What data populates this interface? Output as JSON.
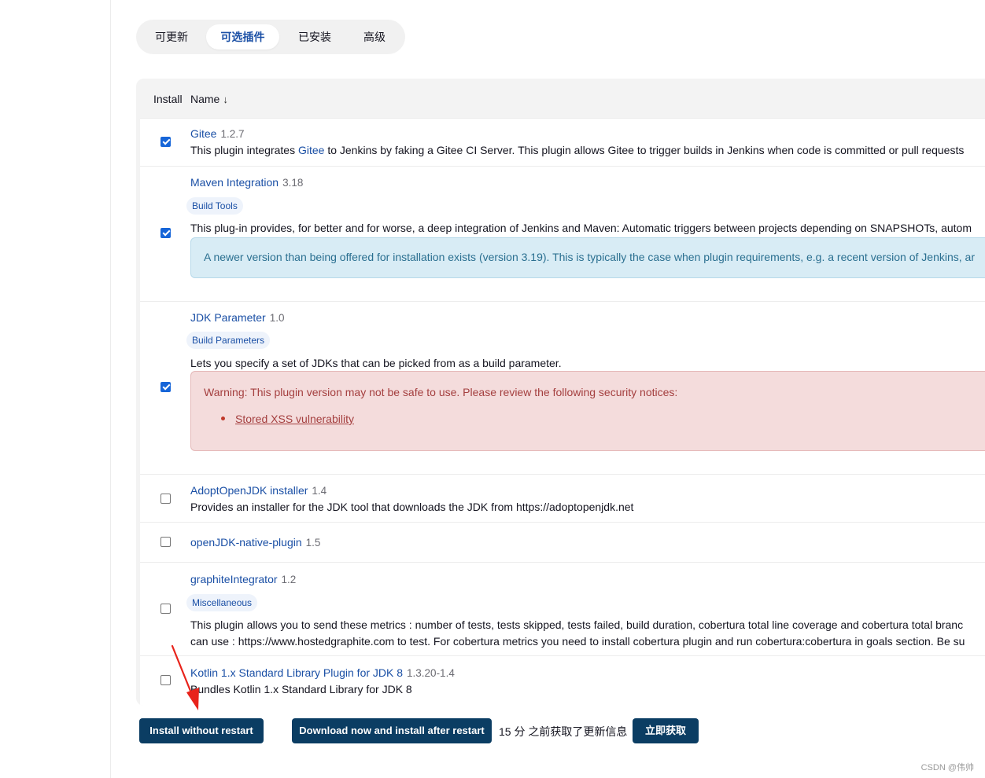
{
  "tabs": [
    {
      "label": "可更新",
      "active": false
    },
    {
      "label": "可选插件",
      "active": true
    },
    {
      "label": "已安装",
      "active": false
    },
    {
      "label": "高级",
      "active": false
    }
  ],
  "table": {
    "header": {
      "install": "Install",
      "name": "Name",
      "sort_indicator": "↓"
    }
  },
  "plugins": [
    {
      "name": "Gitee",
      "version": "1.2.7",
      "checked": true,
      "desc_before": "This plugin integrates ",
      "desc_link": "Gitee",
      "desc_after": " to Jenkins by faking a Gitee CI Server. This plugin allows Gitee to trigger builds in Jenkins when code is committed or pull requests"
    },
    {
      "name": "Maven Integration",
      "version": "3.18",
      "checked": true,
      "tag": "Build Tools",
      "desc": "This plug-in provides, for better and for worse, a deep integration of Jenkins and Maven: Automatic triggers between projects depending on SNAPSHOTs, autom",
      "notice": "A newer version than being offered for installation exists (version 3.19). This is typically the case when plugin requirements, e.g. a recent version of Jenkins, ar"
    },
    {
      "name": "JDK Parameter",
      "version": "1.0",
      "checked": true,
      "tag": "Build Parameters",
      "desc": "Lets you specify a set of JDKs that can be picked from as a build parameter.",
      "warning": "Warning: This plugin version may not be safe to use. Please review the following security notices:",
      "warning_link": "Stored XSS vulnerability"
    },
    {
      "name": "AdoptOpenJDK installer",
      "version": "1.4",
      "checked": false,
      "desc": "Provides an installer for the JDK tool that downloads the JDK from https://adoptopenjdk.net"
    },
    {
      "name": "openJDK-native-plugin",
      "version": "1.5",
      "checked": false
    },
    {
      "name": "graphiteIntegrator",
      "version": "1.2",
      "checked": false,
      "tag": "Miscellaneous",
      "desc": "This plugin allows you to send these metrics : number of tests, tests skipped, tests failed, build duration, cobertura total line coverage and cobertura total branc",
      "desc2": "can use : https://www.hostedgraphite.com to test. For cobertura metrics you need to install cobertura plugin and run cobertura:cobertura in goals section. Be su"
    },
    {
      "name": "Kotlin 1.x Standard Library Plugin for JDK 8",
      "version": "1.3.20-1.4",
      "checked": false,
      "desc": "Bundles Kotlin 1.x Standard Library for JDK 8"
    }
  ],
  "actions": {
    "install_without_restart": "Install without restart",
    "download_and_install": "Download now and install after restart",
    "update_info": "15 分 之前获取了更新信息",
    "fetch_now": "立即获取"
  },
  "watermark": "CSDN @伟帅",
  "colors": {
    "link": "#1a4fa5",
    "button": "#0b3d63",
    "checkbox": "#1665d8",
    "arrow": "#e8231b"
  }
}
